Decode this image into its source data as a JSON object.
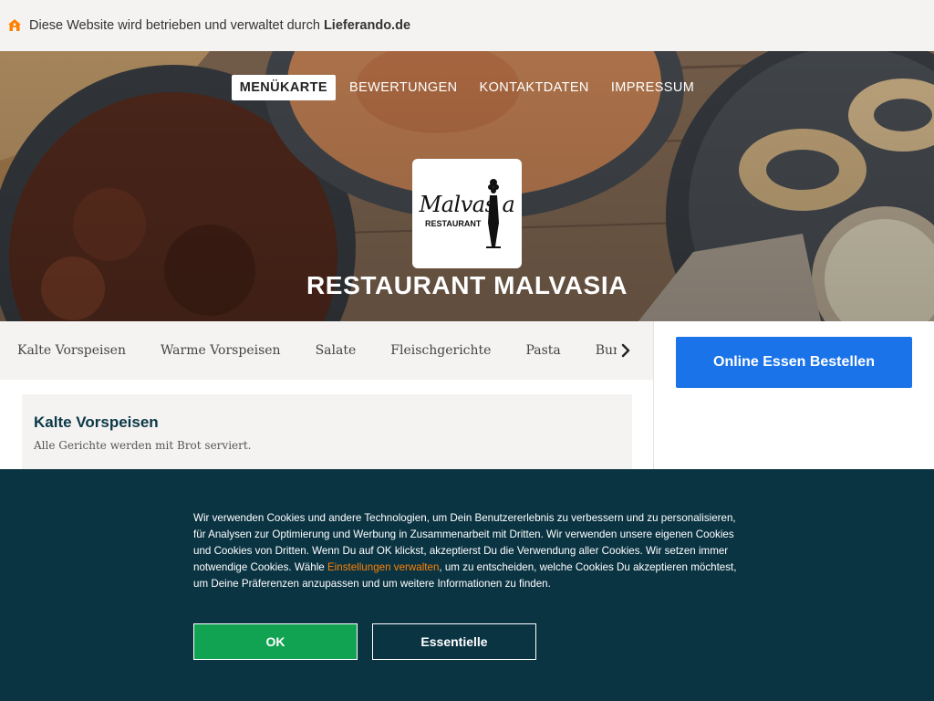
{
  "topbar": {
    "text_prefix": "Diese Website wird betrieben und verwaltet durch ",
    "brand": "Lieferando.de",
    "icon": "home-icon"
  },
  "nav": {
    "items": [
      "MENÜKARTE",
      "BEWERTUNGEN",
      "KONTAKTDATEN",
      "IMPRESSUM"
    ],
    "active_index": 0
  },
  "logo": {
    "word": "Malvas a",
    "sub": "RESTAURANT"
  },
  "restaurant": {
    "name": "RESTAURANT MALVASIA"
  },
  "categories": {
    "items": [
      "Kalte Vorspeisen",
      "Warme Vorspeisen",
      "Salate",
      "Fleischgerichte",
      "Pasta",
      "Burg"
    ],
    "arrow_icon": "chevron-right-icon"
  },
  "order": {
    "button_label": "Online Essen Bestellen"
  },
  "section": {
    "title": "Kalte Vorspeisen",
    "description": "Alle Gerichte werden mit Brot serviert."
  },
  "cookie": {
    "text_before_link": "Wir verwenden Cookies und andere Technologien, um Dein Benutzererlebnis zu verbessern und zu personalisieren, für Analysen zur Optimierung und Werbung in Zusammenarbeit mit Dritten. Wir verwenden unsere eigenen Cookies und Cookies von Dritten. Wenn Du auf OK klickst, akzeptierst Du die Verwendung aller Cookies. Wir setzen immer notwendige Cookies. Wähle ",
    "link_text": "Einstellungen verwalten",
    "text_after_link": ", um zu entscheiden, welche Cookies Du akzeptieren möchtest, um Deine Präferenzen anzupassen und um weitere Informationen zu finden.",
    "ok_label": "OK",
    "essential_label": "Essentielle"
  },
  "colors": {
    "topbar_bg": "#f5f3f1",
    "order_button": "#1a73e8",
    "cookie_bg": "#0b3443",
    "ok_button": "#12a352",
    "link": "#ff8000",
    "section_title": "#0a3847",
    "brand_orange": "#ff8000"
  }
}
